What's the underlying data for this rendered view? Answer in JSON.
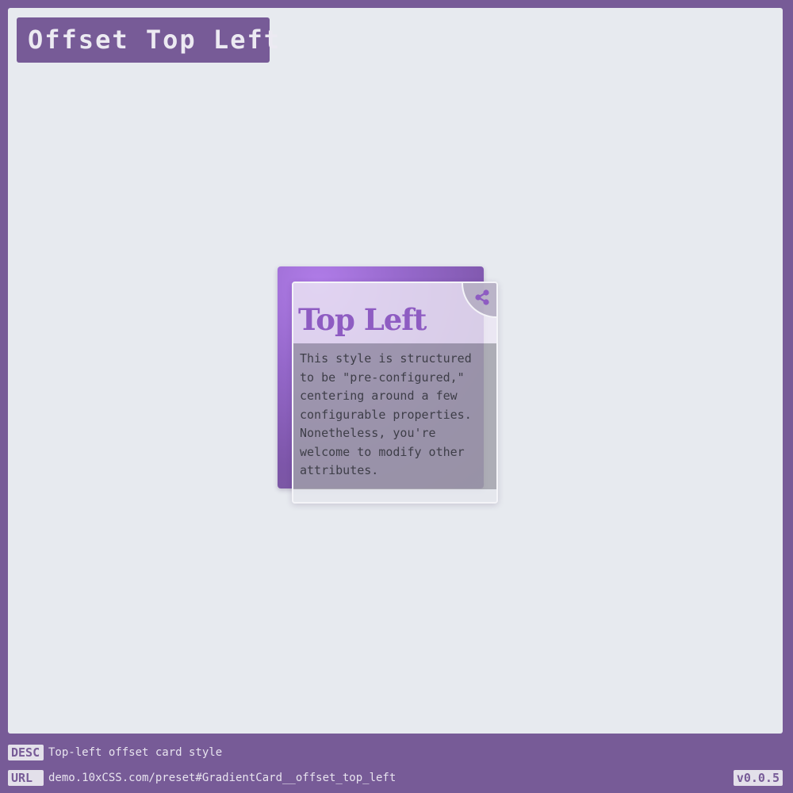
{
  "page": {
    "title": "Offset Top Left"
  },
  "card": {
    "title": "Top Left",
    "text": "This style is structured to be \"pre-configured,\" centering around a few configurable properties. Nonetheless, you're welcome to modify other attributes.",
    "action_icon": "share-icon"
  },
  "footer": {
    "desc_tag": "DESC",
    "desc_text": "Top-left offset card style",
    "url_tag": "URL",
    "url_text": "demo.10xCSS.com/preset#GradientCard__offset_top_left",
    "version": "v0.0.5"
  },
  "colors": {
    "frame": "#775b97",
    "canvas": "#e7eaef",
    "accent": "#8e5cc2"
  }
}
